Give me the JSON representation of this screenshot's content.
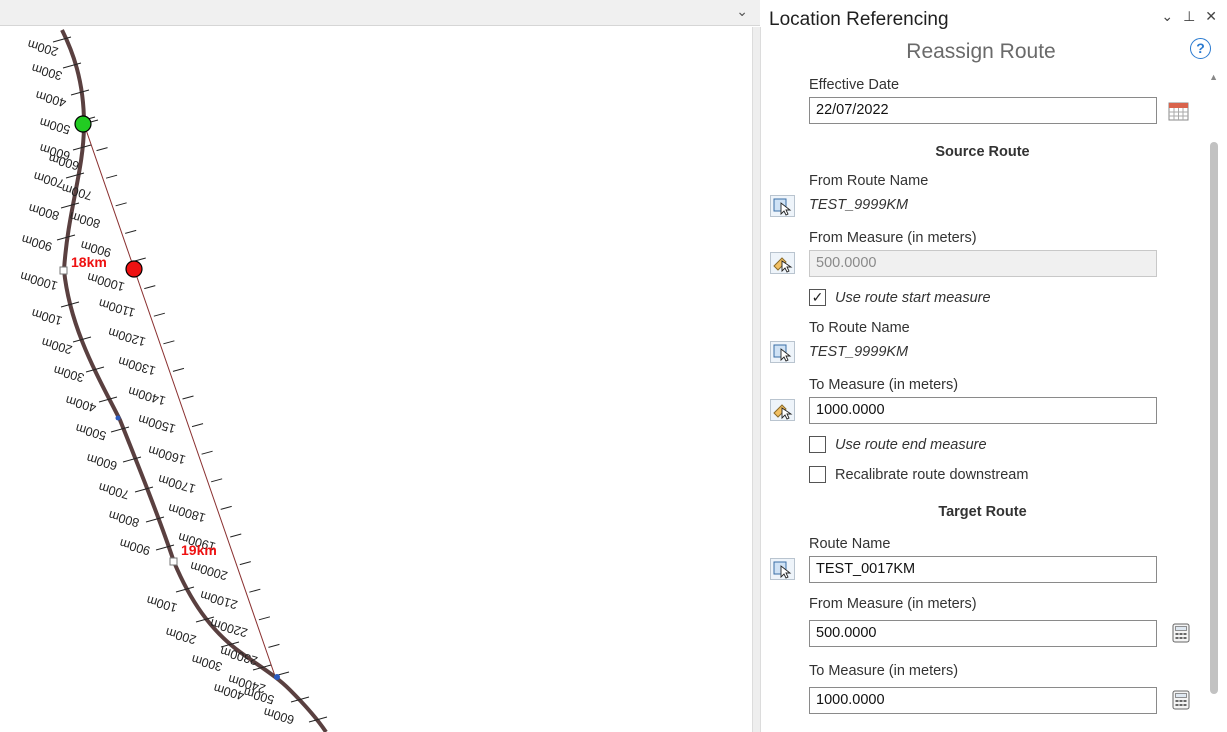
{
  "pane": {
    "title": "Location Referencing",
    "controls": [
      "⌄",
      "⊥",
      "✕"
    ],
    "tool_title": "Reassign Route",
    "help": "?"
  },
  "form": {
    "effective_date_label": "Effective Date",
    "effective_date_value": "22/07/2022",
    "source_header": "Source Route",
    "from_route_name_label": "From Route Name",
    "from_route_name_value": "TEST_9999KM",
    "from_measure_label": "From Measure (in meters)",
    "from_measure_value": "500.0000",
    "use_start_label": "Use route start measure",
    "use_start_checked": "✓",
    "to_route_name_label": "To Route Name",
    "to_route_name_value": "TEST_9999KM",
    "to_measure_label": "To Measure (in meters)",
    "to_measure_value": "1000.0000",
    "use_end_label": "Use route end measure",
    "recalibrate_label": "Recalibrate route downstream",
    "target_header": "Target Route",
    "route_name_label": "Route Name",
    "route_name_value": "TEST_0017KM",
    "target_from_label": "From Measure (in meters)",
    "target_from_value": "500.0000",
    "target_to_label": "To Measure (in meters)",
    "target_to_value": "1000.0000"
  },
  "map": {
    "km_labels": [
      "18km",
      "19km"
    ],
    "left_labels": [
      "200m",
      "300m",
      "400m",
      "500m",
      "600m",
      "700m",
      "800m",
      "900m",
      "1000m",
      "100m",
      "200m",
      "300m",
      "400m",
      "500m",
      "600m",
      "700m",
      "800m",
      "900m",
      "100m",
      "200m",
      "300m",
      "400m"
    ],
    "right_labels": [
      "600m",
      "700m",
      "800m",
      "900m",
      "1000m",
      "1100m",
      "1200m",
      "1300m",
      "1400m",
      "1500m",
      "1600m",
      "1700m",
      "1800m",
      "1900m",
      "2000m",
      "2100m",
      "2200m",
      "2300m",
      "2400m",
      "500m",
      "600m"
    ],
    "colors": {
      "route": "#5a4040",
      "start_point": "#22cc22",
      "end_point": "#ee1111",
      "km_text": "#ee1111"
    }
  }
}
